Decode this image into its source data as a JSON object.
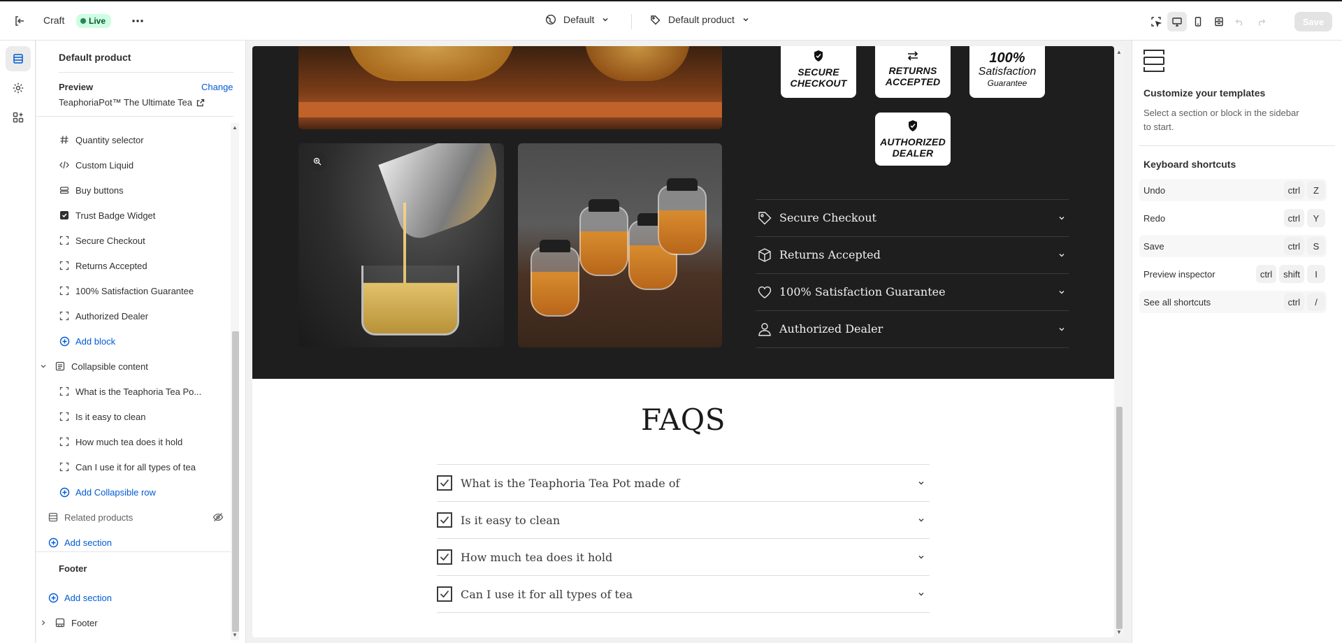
{
  "topbar": {
    "store_name": "Craft",
    "status_badge": "Live",
    "theme_selector": "Default",
    "template_selector": "Default product",
    "save_label": "Save"
  },
  "sidebar": {
    "heading": "Default product",
    "preview_label": "Preview",
    "change_link": "Change",
    "preview_product": "TeaphoriaPot™ The Ultimate Tea",
    "blocks": [
      {
        "label": "Quantity selector",
        "icon": "hash-icon"
      },
      {
        "label": "Custom Liquid",
        "icon": "code-icon"
      },
      {
        "label": "Buy buttons",
        "icon": "buy-buttons-icon"
      },
      {
        "label": "Trust Badge Widget",
        "icon": "app-block-icon"
      },
      {
        "label": "Secure Checkout",
        "icon": "block-frame-icon"
      },
      {
        "label": "Returns Accepted",
        "icon": "block-frame-icon"
      },
      {
        "label": "100% Satisfaction Guarantee",
        "icon": "block-frame-icon"
      },
      {
        "label": "Authorized Dealer",
        "icon": "block-frame-icon"
      }
    ],
    "add_block": "Add block",
    "collapsible_section": "Collapsible content",
    "collapsible_rows": [
      "What is the Teaphoria Tea Po...",
      "Is it easy to clean",
      "How much tea does it hold",
      "Can I use it for all types of tea"
    ],
    "add_collapsible_row": "Add Collapsible row",
    "related_products": "Related products",
    "add_section": "Add section",
    "footer_heading": "Footer",
    "footer_add_section": "Add section",
    "footer_section": "Footer"
  },
  "canvas": {
    "badges": [
      {
        "lines": [
          "SECURE",
          "CHECKOUT"
        ],
        "icon": "shield-check-icon"
      },
      {
        "lines": [
          "RETURNS",
          "ACCEPTED"
        ],
        "icon": "exchange-arrows-icon"
      },
      {
        "big": "100%",
        "med": "Satisfaction",
        "small": "Guarantee"
      },
      {
        "lines": [
          "AUTHORIZED",
          "DEALER"
        ],
        "icon": "shield-check-icon"
      }
    ],
    "accordion": [
      {
        "label": "Secure Checkout",
        "icon": "tag-icon"
      },
      {
        "label": "Returns Accepted",
        "icon": "box-icon"
      },
      {
        "label": "100% Satisfaction Guarantee",
        "icon": "heart-icon"
      },
      {
        "label": "Authorized Dealer",
        "icon": "person-icon"
      }
    ],
    "faq_title": "FAQS",
    "faqs": [
      "What is the Teaphoria Tea Pot made of",
      "Is it easy to clean",
      "How much tea does it hold",
      "Can I use it for all types of tea"
    ]
  },
  "right_panel": {
    "title": "Customize your templates",
    "description": "Select a section or block in the sidebar to start.",
    "shortcuts_heading": "Keyboard shortcuts",
    "shortcuts": [
      {
        "label": "Undo",
        "keys": [
          "ctrl",
          "Z"
        ]
      },
      {
        "label": "Redo",
        "keys": [
          "ctrl",
          "Y"
        ]
      },
      {
        "label": "Save",
        "keys": [
          "ctrl",
          "S"
        ]
      },
      {
        "label": "Preview inspector",
        "keys": [
          "ctrl",
          "shift",
          "I"
        ]
      },
      {
        "label": "See all shortcuts",
        "keys": [
          "ctrl",
          "/"
        ]
      }
    ]
  },
  "colors": {
    "accent_link": "#005bd3",
    "live_badge_bg": "#cdfee1",
    "live_badge_text": "#0c5132",
    "dark_section": "#1e1e1e"
  }
}
